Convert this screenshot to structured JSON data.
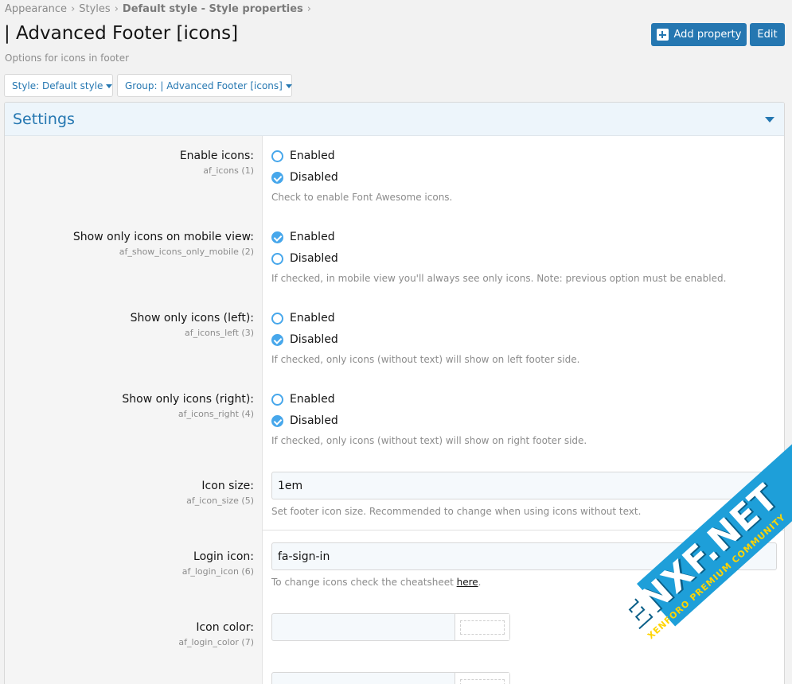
{
  "breadcrumb": [
    {
      "label": "Appearance",
      "bold": false
    },
    {
      "label": "Styles",
      "bold": false
    },
    {
      "label": "Default style - Style properties",
      "bold": true
    }
  ],
  "breadcrumb_separator": "›",
  "page": {
    "title": "| Advanced Footer [icons]",
    "description": "Options for icons in footer"
  },
  "buttons": {
    "add_property": "Add property",
    "edit": "Edit"
  },
  "filters": {
    "style": "Style: Default style",
    "group": "Group: | Advanced Footer [icons]"
  },
  "section": {
    "title": "Settings"
  },
  "radio_options": {
    "enabled": "Enabled",
    "disabled": "Disabled"
  },
  "properties": [
    {
      "label": "Enable icons:",
      "hint": "af_icons (1)",
      "type": "radio",
      "selected": "disabled",
      "explain": "Check to enable Font Awesome icons."
    },
    {
      "label": "Show only icons on mobile view:",
      "hint": "af_show_icons_only_mobile (2)",
      "type": "radio",
      "selected": "enabled",
      "explain": "If checked, in mobile view you'll always see only icons. Note: previous option must be enabled."
    },
    {
      "label": "Show only icons (left):",
      "hint": "af_icons_left (3)",
      "type": "radio",
      "selected": "disabled",
      "explain": "If checked, only icons (without text) will show on left footer side."
    },
    {
      "label": "Show only icons (right):",
      "hint": "af_icons_right (4)",
      "type": "radio",
      "selected": "disabled",
      "explain": "If checked, only icons (without text) will show on right footer side."
    },
    {
      "label": "Icon size:",
      "hint": "af_icon_size (5)",
      "type": "text",
      "value": "1em",
      "explain": "Set footer icon size. Recommended to change when using icons without text."
    },
    {
      "label": "Login icon:",
      "hint": "af_login_icon (6)",
      "type": "text",
      "value": "fa-sign-in",
      "explain_prefix": "To change icons check the cheatsheet ",
      "explain_link": "here",
      "explain_suffix": "."
    },
    {
      "label": "Icon color:",
      "hint": "af_login_color (7)",
      "type": "color",
      "value": ""
    }
  ],
  "watermark": {
    "main": "ENXF.NET",
    "sub": "XENFORO PREMIUM COMMUNITY"
  },
  "colors": {
    "accent": "#2577b1",
    "radio": "#47a7eb",
    "watermark": "#1e9fd9"
  }
}
